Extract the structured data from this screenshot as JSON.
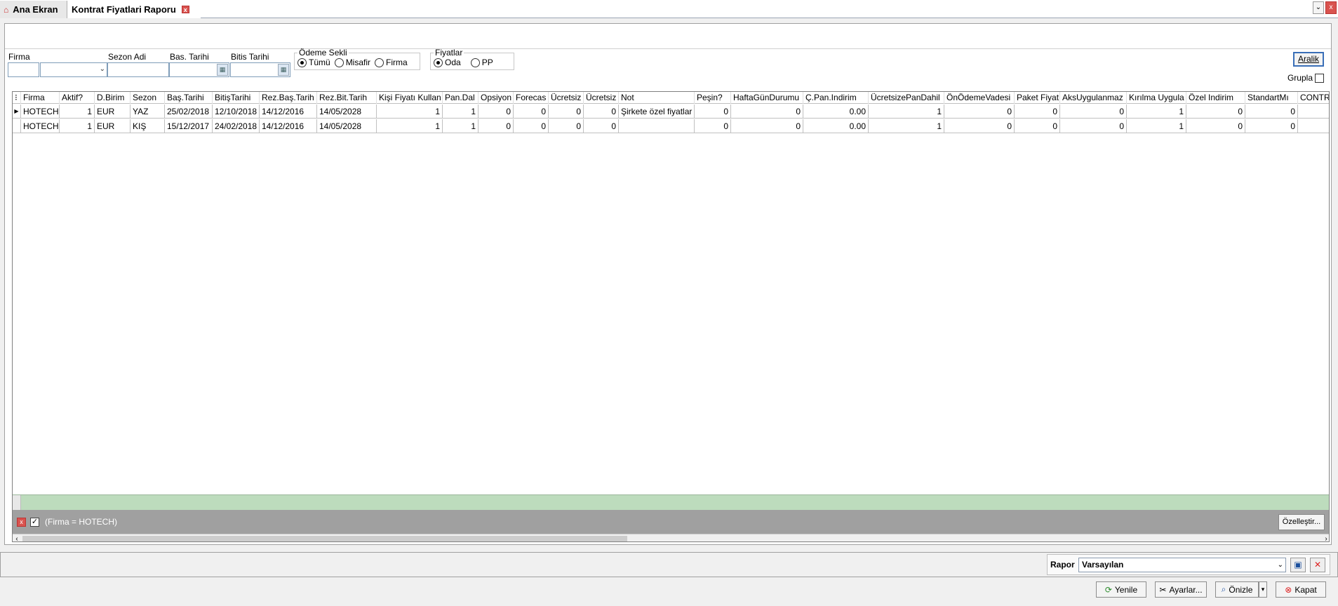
{
  "tabs": [
    {
      "label": "Ana Ekran",
      "icon": "home-icon"
    },
    {
      "label": "Kontrat Fiyatlari Raporu",
      "icon": "close-icon"
    }
  ],
  "filters": {
    "firma_label": "Firma",
    "sezon_label": "Sezon Adi",
    "bas_label": "Bas. Tarihi",
    "bitis_label": "Bitis Tarihi",
    "odeme": {
      "legend": "Ödeme Sekli",
      "options": [
        "Tümü",
        "Misafir",
        "Firma"
      ],
      "selected": "Tümü"
    },
    "fiyatlar": {
      "legend": "Fiyatlar",
      "options": [
        "Oda",
        "PP"
      ],
      "selected": "Oda"
    },
    "aralik_label": "Aralik",
    "grupla_label": "Grupla"
  },
  "grid": {
    "columns": [
      "Firma",
      "Aktif?",
      "D.Birim",
      "Sezon",
      "Baş.Tarihi",
      "BitişTarihi",
      "Rez.Baş.Tarih",
      "Rez.Bit.Tarih",
      "Kişi Fiyatı Kullan",
      "Pan.Dal",
      "Opsiyon",
      "Forecas",
      "Ücretsiz",
      "Ücretsiz",
      "Not",
      "Peşin?",
      "HaftaGünDurumu",
      "Ç.Pan.Indirim",
      "ÜcretsizePanDahil",
      "ÖnÖdemeVadesi",
      "Paket Fiyat",
      "AksUygulanmaz",
      "Kırılma Uygula",
      "Özel Indirim",
      "StandartMı",
      "CONTR"
    ],
    "rows": [
      [
        "HOTECH",
        "1",
        "EUR",
        "YAZ",
        "25/02/2018",
        "12/10/2018",
        "14/12/2016",
        "14/05/2028",
        "1",
        "1",
        "0",
        "0",
        "0",
        "0",
        "Şirkete özel fiyatlar",
        "0",
        "0",
        "0.00",
        "1",
        "0",
        "0",
        "0",
        "1",
        "0",
        "0",
        ""
      ],
      [
        "HOTECH",
        "1",
        "EUR",
        "KIŞ",
        "15/12/2017",
        "24/02/2018",
        "14/12/2016",
        "14/05/2028",
        "1",
        "1",
        "0",
        "0",
        "0",
        "0",
        "",
        "0",
        "0",
        "0.00",
        "1",
        "0",
        "0",
        "0",
        "1",
        "0",
        "0",
        ""
      ]
    ],
    "filter_text": "(Firma = HOTECH)",
    "customize_label": "Özelleştir..."
  },
  "bottom": {
    "rapor_label": "Rapor",
    "rapor_value": "Varsayılan",
    "buttons": [
      "Yenile",
      "Ayarlar...",
      "Önizle",
      "Kapat"
    ]
  }
}
